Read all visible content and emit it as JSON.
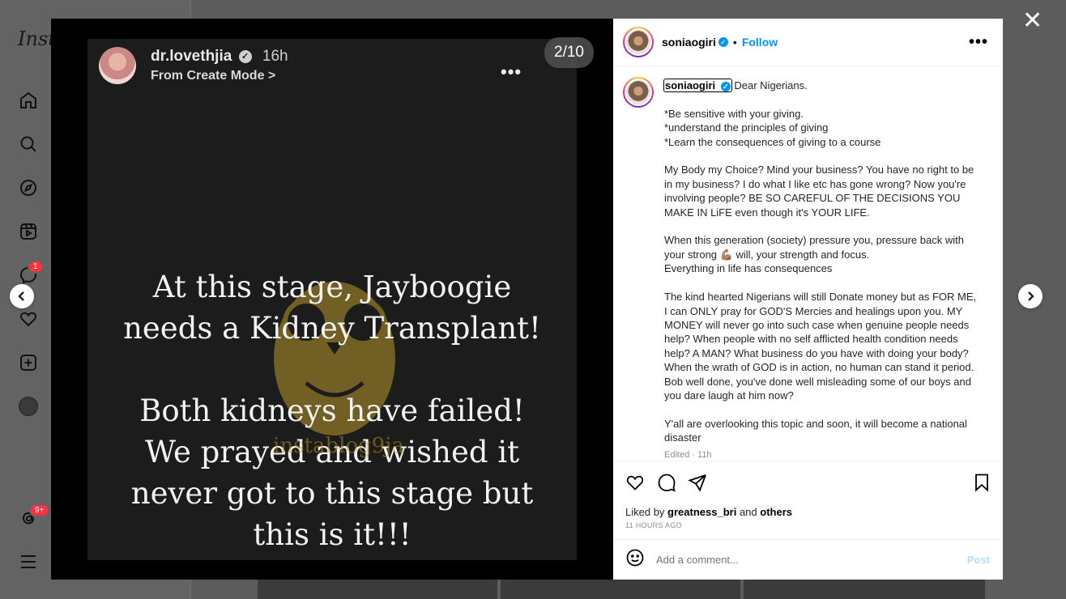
{
  "background": {
    "logo": "Inst",
    "badges": {
      "messages": "1",
      "threads": "9+"
    }
  },
  "media": {
    "counter": "2/10",
    "story": {
      "username": "dr.lovethjia",
      "time": "16h",
      "subtitle": "From Create Mode >",
      "headline_lines": [
        "At this stage, Jayboogie",
        "needs a Kidney Transplant!"
      ],
      "body_lines": [
        "Both kidneys have failed!",
        "We prayed and wished it",
        "never got to this stage but",
        "this is it!!!"
      ],
      "watermark": "instablog9ja"
    }
  },
  "post": {
    "username": "soniaogiri",
    "follow_label": "Follow",
    "caption": "Dear Nigerians.\n\n*Be sensitive with your giving.\n*understand the principles of giving\n*Learn the consequences of giving to a course\n\nMy Body my Choice? Mind your business? You have no right to be in my business? I do what I like etc has gone wrong? Now you're involving people? BE SO CAREFUL OF THE DECISIONS YOU MAKE IN LiFE even though it's YOUR LIFE.\n\nWhen this generation (society) pressure you, pressure back with your strong 💪🏽 will, your strength and focus.\nEverything in life has consequences\n\nThe kind hearted Nigerians will still Donate money but as FOR ME, I can ONLY pray for GOD'S Mercies and healings upon you. MY MONEY will never go into such case when genuine people needs help? When people with no self afflicted health condition needs help? A MAN? What business do you have with doing your body? When the wrath of GOD is in action, no human can stand it period. Bob well done, you've done well misleading some of our boys and you dare laugh at him now?\n\nY'all are overlooking this topic and soon, it will become a national disaster",
    "edited": "Edited · 11h",
    "liked_prefix": "Liked by",
    "liked_user": "greatness_bri",
    "liked_and": "and",
    "liked_others": "others",
    "time_ago": "11 HOURS AGO",
    "comment_placeholder": "Add a comment...",
    "post_label": "Post"
  }
}
